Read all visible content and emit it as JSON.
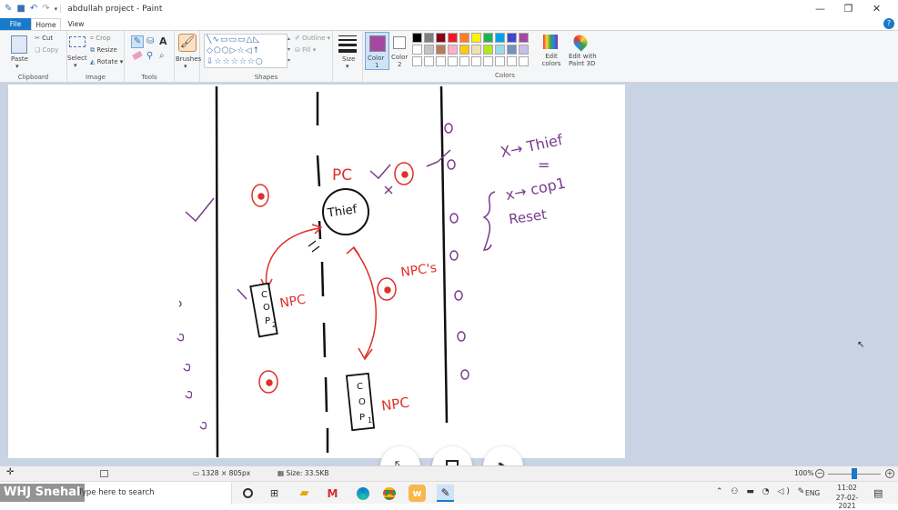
{
  "window": {
    "title": "abdullah project - Paint"
  },
  "tabs": [
    "File",
    "Home",
    "View"
  ],
  "ribbon": {
    "clipboard": {
      "paste": "Paste",
      "cut": "Cut",
      "copy": "Copy",
      "label": "Clipboard"
    },
    "image": {
      "select": "Select",
      "crop": "Crop",
      "resize": "Resize",
      "rotate": "Rotate",
      "label": "Image"
    },
    "tools": {
      "label": "Tools"
    },
    "brushes": {
      "label": "Brushes"
    },
    "shapes": {
      "outline": "Outline",
      "fill": "Fill",
      "label": "Shapes"
    },
    "size": {
      "label": "Size"
    },
    "color1": {
      "label": "Color",
      "num": "1"
    },
    "color2": {
      "label": "Color",
      "num": "2"
    },
    "colors": {
      "label": "Colors",
      "edit_colors": "Edit colors",
      "edit_with": "Edit with",
      "paint3d": "Paint 3D"
    }
  },
  "palette": {
    "row1": [
      "#000000",
      "#7f7f7f",
      "#880015",
      "#ed1c24",
      "#ff7f27",
      "#fff200",
      "#22b14c",
      "#00a2e8",
      "#3f48cc",
      "#a349a4"
    ],
    "row2": [
      "#ffffff",
      "#c3c3c3",
      "#b97a57",
      "#ffaec9",
      "#ffc90e",
      "#efe4b0",
      "#b5e61d",
      "#99d9ea",
      "#7092be",
      "#c8bfe7"
    ],
    "color1": "#a349a4",
    "color2": "#ffffff"
  },
  "sketch": {
    "pc": "PC",
    "thief": "Thief",
    "npc_right": "NPC's",
    "npc_left": "NPC",
    "npc_bottom": "NPC",
    "cop2": [
      "C",
      "O",
      "P",
      "2"
    ],
    "cop1": [
      "C",
      "O",
      "P",
      "1"
    ],
    "x_thief": "X→ Thief",
    "x_cop": "x→ cop1",
    "reset": "Reset",
    "equals": "="
  },
  "status": {
    "dimensions": "1328 × 805px",
    "size": "Size: 33.5KB",
    "zoom": "100%"
  },
  "taskbar": {
    "search": "Type here to search",
    "watermark": "WHJ Snehal",
    "lang": "ENG",
    "time": "11:02",
    "date": "27-02-2021"
  }
}
